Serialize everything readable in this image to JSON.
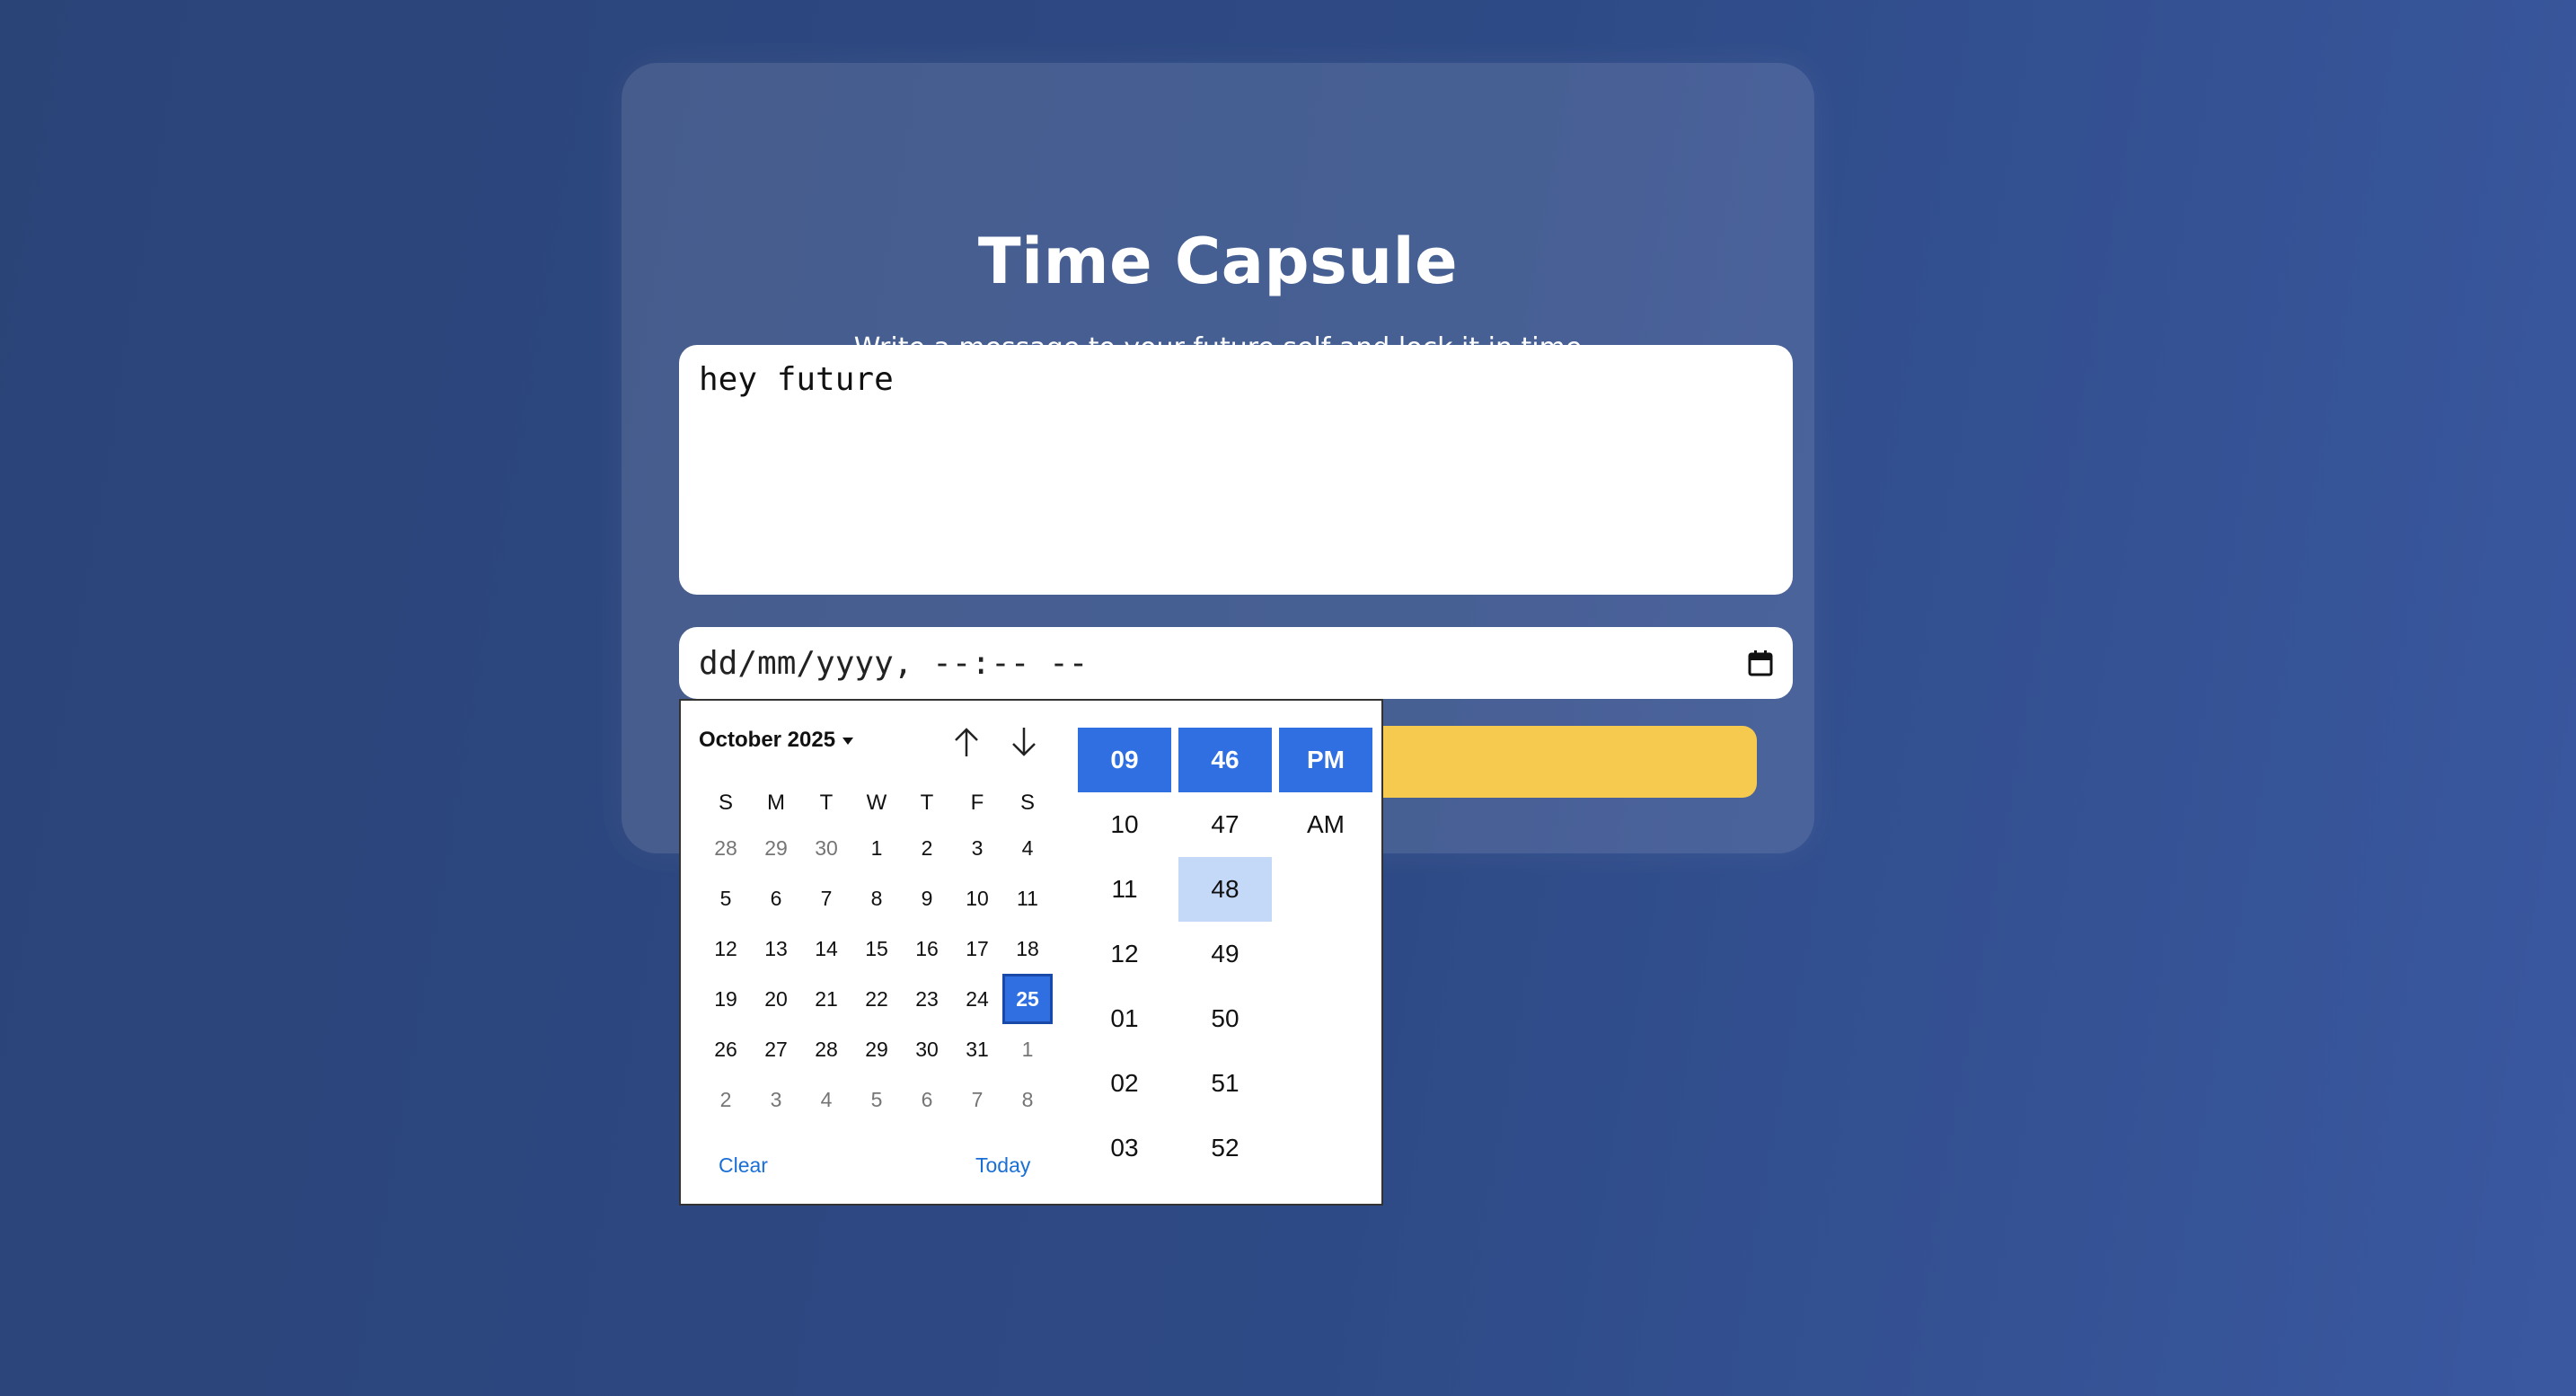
{
  "app": {
    "title": "Time Capsule",
    "subtitle": "Write a message to your future self and lock it in time"
  },
  "form": {
    "message_value": "hey future",
    "datetime_placeholder": "dd/mm/yyyy, --:-- --",
    "datetime_icon": "calendar-icon",
    "button_color": "#f6c94f"
  },
  "picker": {
    "month_label": "October 2025",
    "weekdays": [
      "S",
      "M",
      "T",
      "W",
      "T",
      "F",
      "S"
    ],
    "days": [
      {
        "d": "28",
        "other": true
      },
      {
        "d": "29",
        "other": true
      },
      {
        "d": "30",
        "other": true
      },
      {
        "d": "1"
      },
      {
        "d": "2"
      },
      {
        "d": "3"
      },
      {
        "d": "4"
      },
      {
        "d": "5"
      },
      {
        "d": "6"
      },
      {
        "d": "7"
      },
      {
        "d": "8"
      },
      {
        "d": "9"
      },
      {
        "d": "10"
      },
      {
        "d": "11"
      },
      {
        "d": "12"
      },
      {
        "d": "13"
      },
      {
        "d": "14"
      },
      {
        "d": "15"
      },
      {
        "d": "16"
      },
      {
        "d": "17"
      },
      {
        "d": "18"
      },
      {
        "d": "19"
      },
      {
        "d": "20"
      },
      {
        "d": "21"
      },
      {
        "d": "22"
      },
      {
        "d": "23"
      },
      {
        "d": "24"
      },
      {
        "d": "25",
        "selected": true
      },
      {
        "d": "26"
      },
      {
        "d": "27"
      },
      {
        "d": "28"
      },
      {
        "d": "29"
      },
      {
        "d": "30"
      },
      {
        "d": "31"
      },
      {
        "d": "1",
        "other": true
      },
      {
        "d": "2",
        "other": true
      },
      {
        "d": "3",
        "other": true
      },
      {
        "d": "4",
        "other": true
      },
      {
        "d": "5",
        "other": true
      },
      {
        "d": "6",
        "other": true
      },
      {
        "d": "7",
        "other": true
      },
      {
        "d": "8",
        "other": true
      }
    ],
    "clear_label": "Clear",
    "today_label": "Today",
    "hours": [
      "09",
      "10",
      "11",
      "12",
      "01",
      "02",
      "03"
    ],
    "selected_hour": "09",
    "minutes": [
      "46",
      "47",
      "48",
      "49",
      "50",
      "51",
      "52"
    ],
    "selected_minute": "46",
    "hovered_minute": "48",
    "meridiem": [
      "PM",
      "AM"
    ],
    "selected_meridiem": "PM",
    "accent_color": "#2f6fe2"
  }
}
